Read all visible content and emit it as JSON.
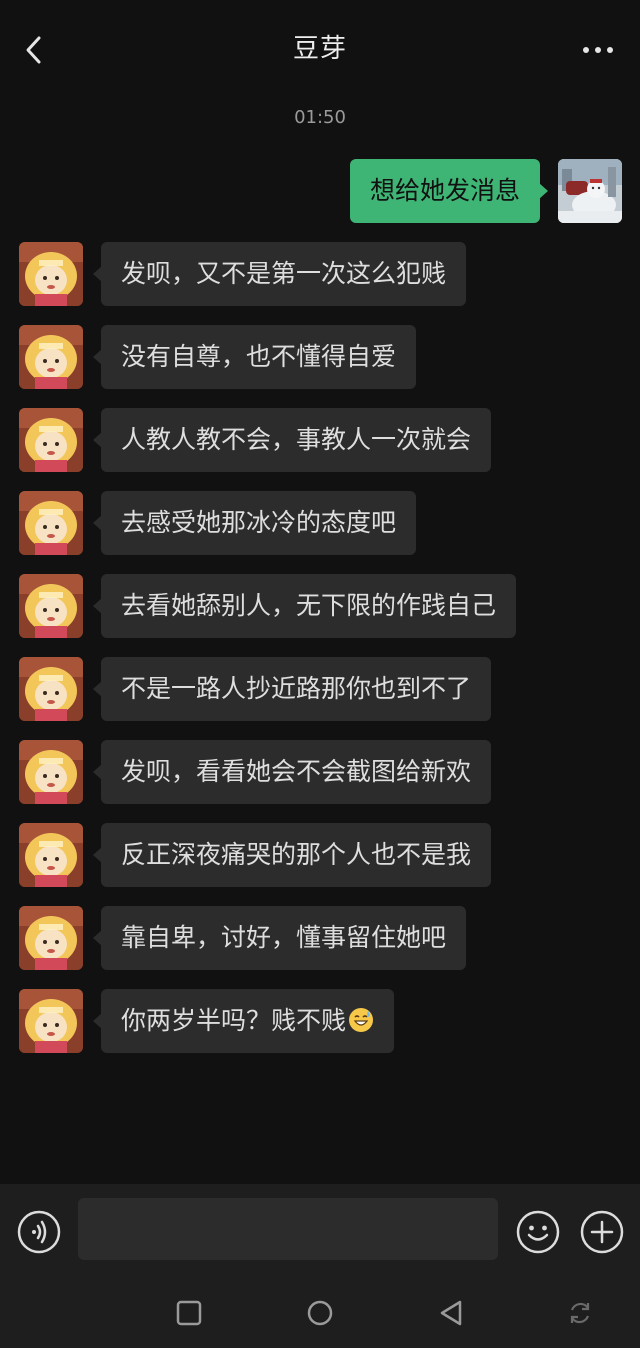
{
  "header": {
    "title": "豆芽",
    "back_icon": "chevron-left-icon",
    "more_icon": "more-horizontal-icon"
  },
  "chat": {
    "timestamp": "01:50",
    "outgoing": [
      {
        "text": "想给她发消息"
      }
    ],
    "incoming": [
      {
        "text": "发呗，又不是第一次这么犯贱"
      },
      {
        "text": "没有自尊，也不懂得自爱"
      },
      {
        "text": "人教人教不会，事教人一次就会"
      },
      {
        "text": "去感受她那冰冷的态度吧"
      },
      {
        "text": "去看她舔别人，无下限的作践自己"
      },
      {
        "text": "不是一路人抄近路那你也到不了"
      },
      {
        "text": "发呗，看看她会不会截图给新欢"
      },
      {
        "text": "反正深夜痛哭的那个人也不是我"
      },
      {
        "text": "靠自卑，讨好，懂事留住她吧"
      },
      {
        "text": "你两岁半吗？贱不贱",
        "emoji": "grinning-sweat-emoji"
      }
    ],
    "colors": {
      "outgoing_bubble": "#3eb575",
      "incoming_bubble": "#2c2c2c",
      "background": "#111111"
    }
  },
  "input_bar": {
    "value": "",
    "placeholder": "",
    "voice_icon": "voice-icon",
    "emoji_icon": "smiley-icon",
    "plus_icon": "plus-circle-icon"
  },
  "navbar": {
    "items": [
      "square-icon",
      "circle-icon",
      "triangle-back-icon",
      "rotate-icon"
    ]
  }
}
